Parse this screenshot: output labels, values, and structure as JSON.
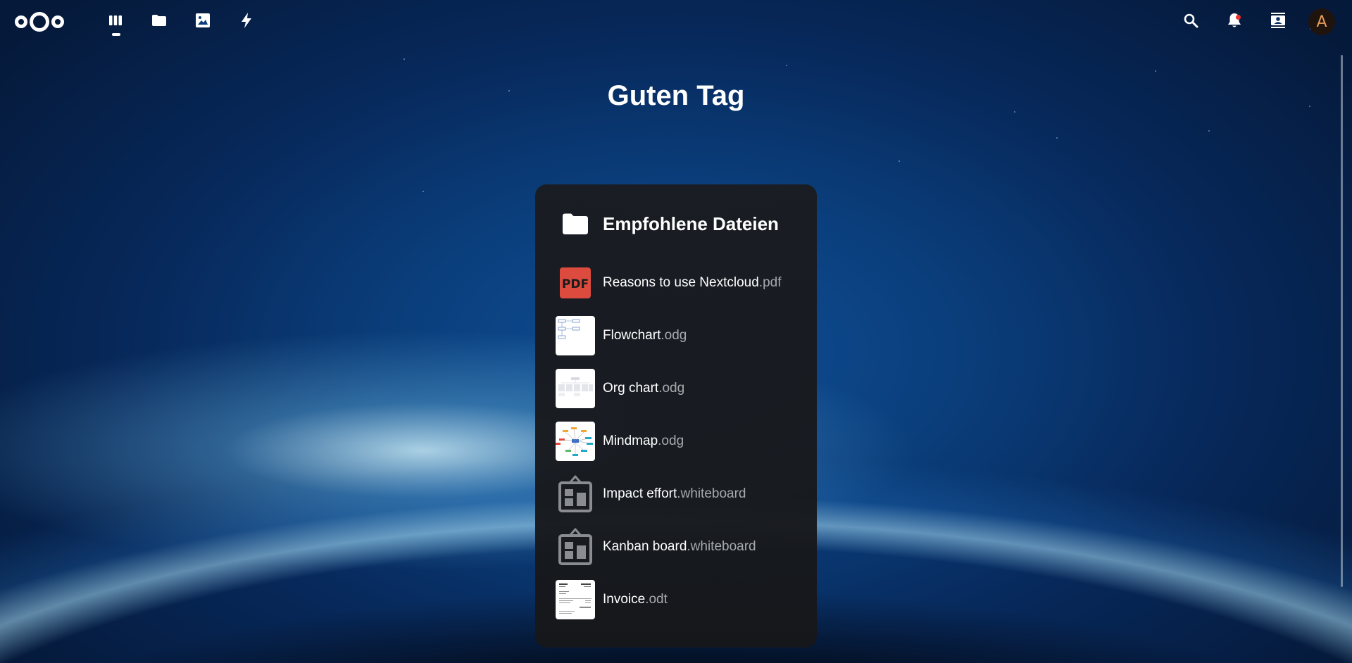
{
  "header": {
    "apps": [
      {
        "name": "dashboard",
        "icon": "dashboard-icon",
        "active": true
      },
      {
        "name": "files",
        "icon": "folder-icon",
        "active": false
      },
      {
        "name": "photos",
        "icon": "image-icon",
        "active": false
      },
      {
        "name": "activity",
        "icon": "lightning-icon",
        "active": false
      }
    ],
    "right_icons": [
      "search-icon",
      "bell-icon",
      "contacts-icon"
    ],
    "avatar_initial": "A"
  },
  "greeting": "Guten Tag",
  "widget": {
    "title": "Empfohlene Dateien",
    "files": [
      {
        "name": "Reasons to use Nextcloud",
        "ext": ".pdf",
        "thumb": "pdf"
      },
      {
        "name": "Flowchart",
        "ext": ".odg",
        "thumb": "flowchart"
      },
      {
        "name": "Org chart",
        "ext": ".odg",
        "thumb": "orgchart"
      },
      {
        "name": "Mindmap",
        "ext": ".odg",
        "thumb": "mindmap"
      },
      {
        "name": "Impact effort",
        "ext": ".whiteboard",
        "thumb": "whiteboard"
      },
      {
        "name": "Kanban board",
        "ext": ".whiteboard",
        "thumb": "whiteboard"
      },
      {
        "name": "Invoice",
        "ext": ".odt",
        "thumb": "invoice"
      }
    ]
  },
  "colors": {
    "notification_dot": "#e9322d",
    "pdf_red": "#dc4b3e",
    "avatar_bg": "#1f130d",
    "avatar_text": "#e79b5a"
  }
}
